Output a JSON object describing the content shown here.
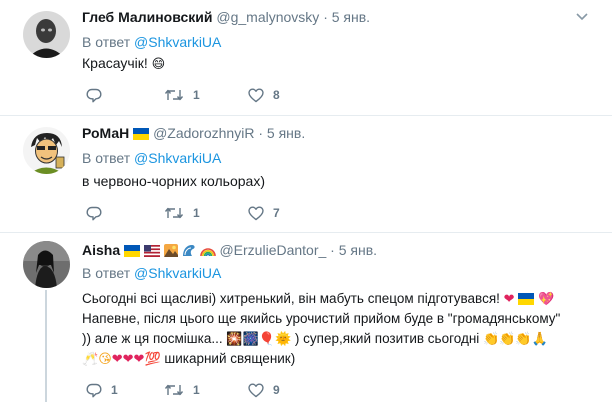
{
  "tweets": [
    {
      "name": "Глеб Малиновский",
      "handle": "@g_malynovsky",
      "time": "5 янв.",
      "reply_prefix": "В ответ",
      "reply_to": "@ShkvarkiUA",
      "text": "Красаучік!",
      "retweets": "1",
      "likes": "8"
    },
    {
      "name": "РоМаН",
      "handle": "@ZadorozhnyiR",
      "time": "5 янв.",
      "reply_prefix": "В ответ",
      "reply_to": "@ShkvarkiUA",
      "text": "в червоно-чорних кольорах)",
      "retweets": "1",
      "likes": "7"
    },
    {
      "name": "Aisha",
      "handle": "@ErzulieDantor_",
      "time": "5 янв.",
      "reply_prefix": "В ответ",
      "reply_to": "@ShkvarkiUA",
      "text_line1": "Сьогодні всі щасливі) хитренький, він мабуть спецом підготувався!",
      "text_line2": "Напевне, після цього ще якийсь урочистий прийом буде в \"громадянському\"",
      "text_line3a": ")) але ж ця посмішка...",
      "text_line3b": ") супер,який позитив сьогодні",
      "text_line4": "шикарний священик)",
      "replies": "1",
      "retweets": "1",
      "likes": "9"
    }
  ],
  "dot": "·",
  "colors": {
    "accent": "#1b95e0",
    "meta": "#657786",
    "heart": "#e0245e"
  }
}
